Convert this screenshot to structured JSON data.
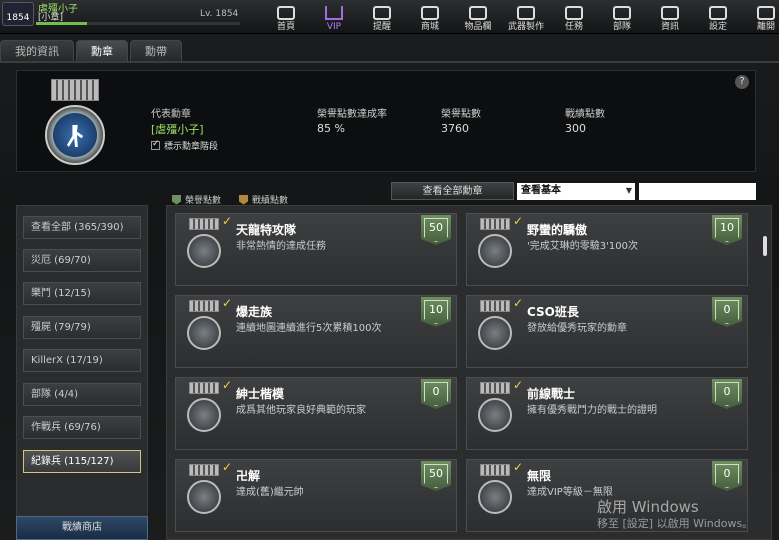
{
  "player": {
    "name": "虐殭小子",
    "clan": "[小章]",
    "level_label": "Lv. 1854",
    "badge_level": "1854"
  },
  "nav": [
    {
      "label": "首頁",
      "icon": "home-icon"
    },
    {
      "label": "VIP",
      "icon": "vip-crown-icon"
    },
    {
      "label": "提醒",
      "icon": "megaphone-icon"
    },
    {
      "label": "商城",
      "icon": "shop-icon"
    },
    {
      "label": "物品欄",
      "icon": "inventory-icon"
    },
    {
      "label": "武器製作",
      "icon": "weapon-craft-icon"
    },
    {
      "label": "任務",
      "icon": "mission-icon"
    },
    {
      "label": "部隊",
      "icon": "clan-icon"
    },
    {
      "label": "資訊",
      "icon": "info-icon"
    },
    {
      "label": "設定",
      "icon": "gear-icon"
    },
    {
      "label": "離開",
      "icon": "power-icon"
    }
  ],
  "tabs": [
    "我的資訊",
    "勳章",
    "勳帶"
  ],
  "header": {
    "rep_label": "代表勳章",
    "rep_name": "[虐殭小子]",
    "show_level": "標示勳章階段",
    "rate_label": "榮譽點數達成率",
    "rate_value": "85 %",
    "honor_label": "榮譽點數",
    "honor_value": "3760",
    "battle_label": "戰績點數",
    "battle_value": "300",
    "help": "?"
  },
  "legend": {
    "honor": "榮譽點數",
    "battle": "戰績點數"
  },
  "filter": {
    "view_all": "查看全部勳章",
    "select_value": "查看基本",
    "search_value": ""
  },
  "categories": [
    "查看全部 (365/390)",
    "災厄 (69/70)",
    "樂鬥 (12/15)",
    "殭屍 (79/79)",
    "KillerX (17/19)",
    "部隊 (4/4)",
    "作戰兵 (69/76)",
    "紀錄兵 (115/127)"
  ],
  "shop": "戰績商店",
  "medals": [
    {
      "title": "天龍特攻隊",
      "desc": "非常熱情的達成任務",
      "points": "50"
    },
    {
      "title": "野蠻的驕傲",
      "desc": "'完成艾琳的零驗3'100次",
      "points": "10"
    },
    {
      "title": "爆走族",
      "desc": "連續地圖連續進行5次累積100次",
      "points": "10"
    },
    {
      "title": "CSO班長",
      "desc": "發放給優秀玩家的勳章",
      "points": "0"
    },
    {
      "title": "紳士楷模",
      "desc": "成爲其他玩家良好典範的玩家",
      "points": "0"
    },
    {
      "title": "前線戰士",
      "desc": "擁有優秀戰鬥力的戰士的證明",
      "points": "0"
    },
    {
      "title": "卍解",
      "desc": "達成(舊)繼元帥",
      "points": "50"
    },
    {
      "title": "無限",
      "desc": "達成VIP等級－無限",
      "points": "0"
    }
  ],
  "watermark": {
    "line1": "啟用 Windows",
    "line2": "移至 [設定] 以啟用 Windows。"
  },
  "colors": {
    "accent_green": "#9fe26a",
    "vip_purple": "#b07ef0",
    "points_green": "#5f7d54",
    "active_border": "#d6c47a"
  }
}
